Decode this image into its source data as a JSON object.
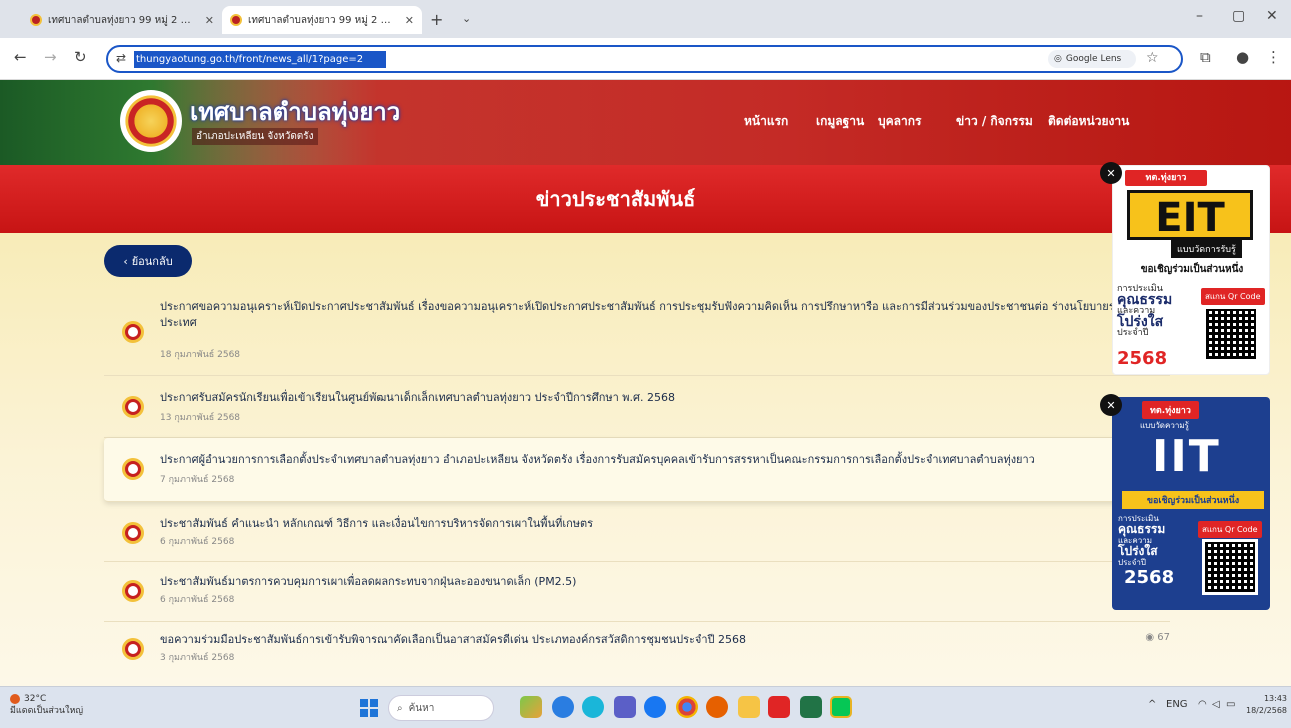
{
  "browser": {
    "tabs": [
      {
        "title": "เทศบาลตำบลทุ่งยาว 99 หมู่ 2 ตำบล",
        "active": false
      },
      {
        "title": "เทศบาลตำบลทุ่งยาว 99 หมู่ 2 ตำบล",
        "active": true
      }
    ],
    "new_tab": "+",
    "tab_list": "⌄",
    "window_controls": {
      "minimize": "–",
      "maximize": "▢",
      "close": "✕"
    },
    "url": "thungyaotung.go.th/front/news_all/1?page=2",
    "lens_label": "Google Lens",
    "nav_icons": {
      "back": "←",
      "forward": "→",
      "reload": "↻",
      "tune": "⇄",
      "star": "☆",
      "extensions": "⧉",
      "profile": "●",
      "menu": "⋮"
    }
  },
  "site": {
    "title": "เทศบาลตำบลทุ่งยาว",
    "subtitle": "อำเภอปะเหลียน จังหวัดตรัง",
    "menu": [
      "หน้าแรก",
      "เกมูลฐาน",
      "บุคลากร",
      "ข่าว / กิจกรรม",
      "ติดต่อหน่วยงาน"
    ]
  },
  "section_title": "ข่าวประชาสัมพันธ์",
  "back_button": {
    "icon": "‹",
    "label": "ย้อนกลับ"
  },
  "news": [
    {
      "title": "ประกาศขอความอนุเคราะห์เปิดประกาศประชาสัมพันธ์ เรื่องขอความอนุเคราะห์เปิดประกาศประชาสัมพันธ์ การประชุมรับฟังความคิดเห็น การปรึกษาหารือ และการมีส่วนร่วมของประชาชนต่อ ร่างนโยบายระดับประเทศ",
      "date": "18 กุมภาพันธ์ 2568",
      "views": ""
    },
    {
      "title": "ประกาศรับสมัครนักเรียนเพื่อเข้าเรียนในศูนย์พัฒนาเด็กเล็กเทศบาลตำบลทุ่งยาว ประจำปีการศึกษา พ.ศ. 2568",
      "date": "13 กุมภาพันธ์ 2568",
      "views": ""
    },
    {
      "title": "ประกาศผู้อำนวยการการเลือกตั้งประจำเทศบาลตำบลทุ่งยาว อำเภอปะเหลียน จังหวัดตรัง เรื่องการรับสมัครบุคคลเข้ารับการสรรหาเป็นคณะกรรมการการเลือกตั้งประจำเทศบาลตำบลทุ่งยาว",
      "date": "7 กุมภาพันธ์ 2568",
      "views": ""
    },
    {
      "title": "ประชาสัมพันธ์ คำแนะนำ หลักเกณฑ์ วิธีการ และเงื่อนไขการบริหารจัดการเผาในพื้นที่เกษตร",
      "date": "6 กุมภาพันธ์ 2568",
      "views": ""
    },
    {
      "title": "ประชาสัมพันธ์มาตรการควบคุมการเผาเพื่อลดผลกระทบจากฝุ่นละอองขนาดเล็ก (PM2.5)",
      "date": "6 กุมภาพันธ์ 2568",
      "views": ""
    },
    {
      "title": "ขอความร่วมมือประชาสัมพันธ์การเข้ารับพิจารณาคัดเลือกเป็นอาสาสมัครดีเด่น ประเภทองค์กรสวัสดิการชุมชนประจำปี 2568",
      "date": "3 กุมภาพันธ์ 2568",
      "views": "67"
    }
  ],
  "badges": {
    "eit": {
      "header": "ทต.ทุ่งยาว",
      "big": "EIT",
      "tag": "แบบวัดการรับรู้",
      "invite": "ขอเชิญร่วมเป็นส่วนหนึ่ง",
      "label_small": "การประเมิน",
      "label_big": "คุณธรรม",
      "label_small2": "และความ",
      "label_big2": "โปร่งใส",
      "label_small3": "ประจำปี",
      "year": "2568",
      "scan": "สแกน Qr Code"
    },
    "iit": {
      "header": "ทต.ทุ่งยาว",
      "sub": "แบบวัดความรู้",
      "big": "IIT",
      "invite": "ขอเชิญร่วมเป็นส่วนหนึ่ง",
      "label_small": "การประเมิน",
      "label_big": "คุณธรรม",
      "label_small2": "และความ",
      "label_big2": "โปร่งใส",
      "label_small3": "ประจำปี",
      "year": "2568",
      "scan": "สแกน Qr Code"
    },
    "close": "✕"
  },
  "taskbar": {
    "weather_temp": "32°C",
    "weather_desc": "มีแดดเป็นส่วนใหญ่",
    "search_placeholder": "ค้นหา",
    "tray": {
      "lang": "ENG",
      "arrow": "^"
    },
    "time": "13:43",
    "date": "18/2/2568"
  }
}
